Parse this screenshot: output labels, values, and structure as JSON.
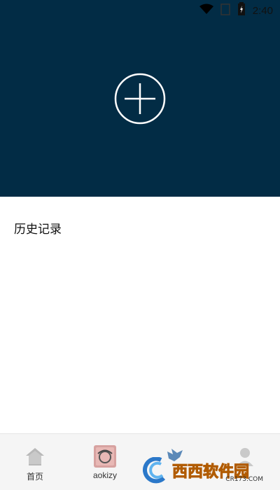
{
  "status_bar": {
    "time": "2:40",
    "icons": [
      "wifi-icon",
      "signal-icon",
      "battery-icon"
    ]
  },
  "header": {
    "background_color": "#022c45",
    "add_button_icon": "plus-circle-icon"
  },
  "history": {
    "title": "历史记录"
  },
  "bottom_nav": {
    "items": [
      {
        "label": "首页",
        "icon": "home-icon"
      },
      {
        "label": "aokizy",
        "icon": "profile-image-icon"
      },
      {
        "label": "",
        "icon": "bird-icon"
      },
      {
        "label": "",
        "icon": "user-icon"
      }
    ]
  },
  "watermark": {
    "main": "西西软件园",
    "sub": "CR173.COM"
  }
}
